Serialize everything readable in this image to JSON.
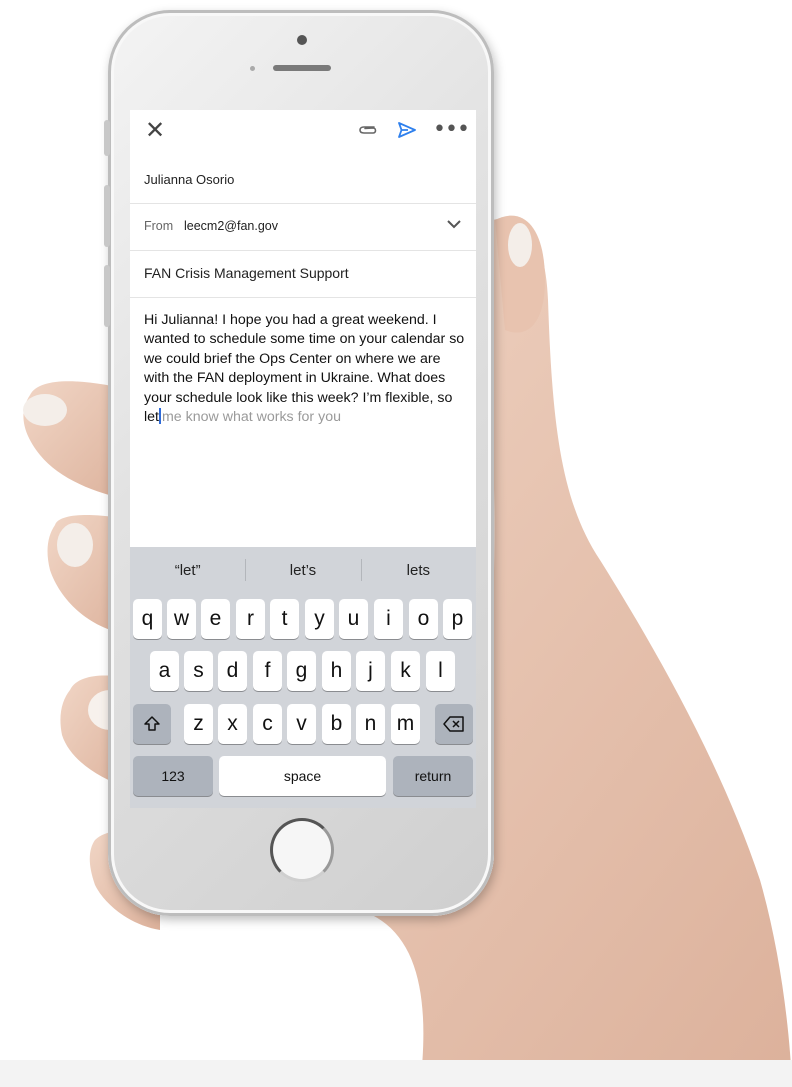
{
  "toolbar": {
    "close_icon": "close-icon",
    "attach_icon": "paperclip-icon",
    "send_icon": "send-icon",
    "more_icon": "more-icon",
    "accent": "#2f80ed"
  },
  "compose": {
    "to_name": "Julianna Osorio",
    "from_label": "From",
    "from_email": "leecm2@fan.gov",
    "subject": "FAN Crisis Management Support",
    "body_typed": "Hi Julianna! I hope you had a great weekend. I wanted to schedule some time on your calendar so we could brief the Ops Center on where we are with the FAN deployment in Ukraine. What does your schedule look like this week? I’m flexible, so let",
    "body_suggestion": "me know what works for you"
  },
  "keyboard": {
    "predictions": [
      "“let”",
      "let’s",
      "lets"
    ],
    "row1": [
      "q",
      "w",
      "e",
      "r",
      "t",
      "y",
      "u",
      "i",
      "o",
      "p"
    ],
    "row2": [
      "a",
      "s",
      "d",
      "f",
      "g",
      "h",
      "j",
      "k",
      "l"
    ],
    "row3": [
      "z",
      "x",
      "c",
      "v",
      "b",
      "n",
      "m"
    ],
    "numbers_label": "123",
    "space_label": "space",
    "return_label": "return"
  }
}
